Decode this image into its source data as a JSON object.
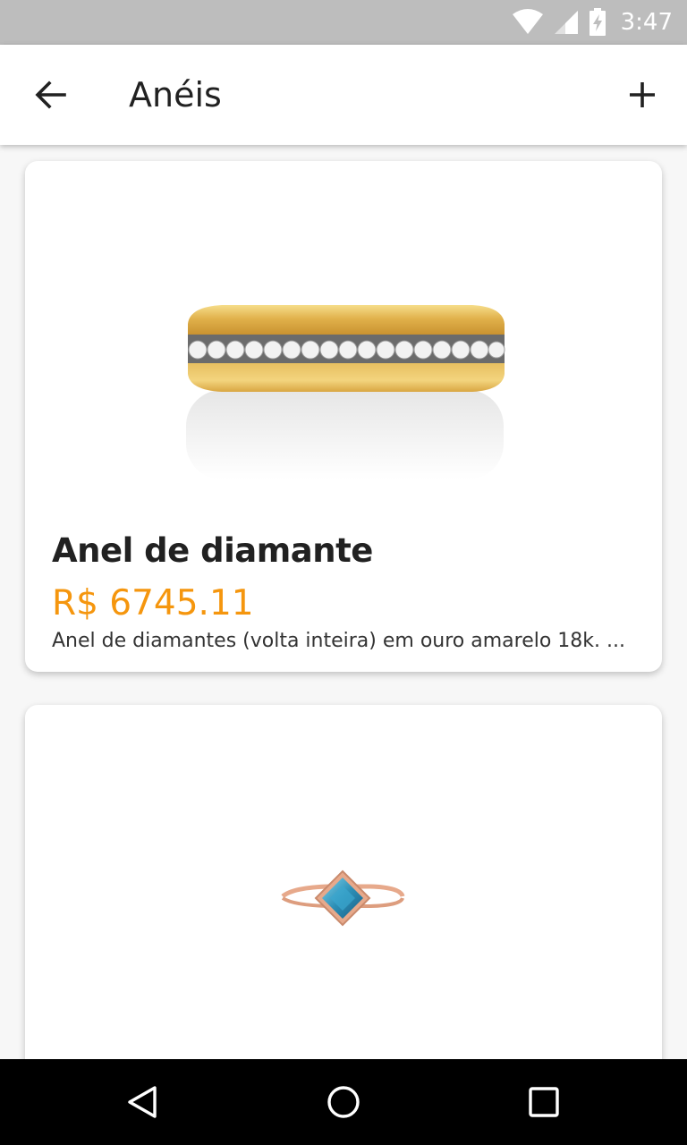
{
  "status_bar": {
    "time": "3:47",
    "icons": [
      "wifi-icon",
      "signal-icon",
      "battery-charging-icon"
    ]
  },
  "app_bar": {
    "title": "Anéis",
    "back_icon": "arrow-back-icon",
    "add_icon": "plus-icon"
  },
  "products": [
    {
      "title": "Anel de diamante",
      "price": "R$ 6745.11",
      "description": "Anel de diamantes (volta inteira) em ouro amarelo 18k. ...",
      "image": "gold-diamond-band-ring"
    },
    {
      "title": "",
      "price": "",
      "description": "",
      "image": "rose-gold-blue-topaz-ring"
    }
  ],
  "navigation": {
    "icons": [
      "back-triangle-icon",
      "home-circle-icon",
      "recents-square-icon"
    ]
  },
  "colors": {
    "status_bar": "#bdbdbd",
    "price": "#f5960e",
    "title": "#212121",
    "background": "#f7f7f7",
    "gold": "#e2b652",
    "rose_gold": "#e7a98b",
    "topaz": "#2d8fb6"
  }
}
